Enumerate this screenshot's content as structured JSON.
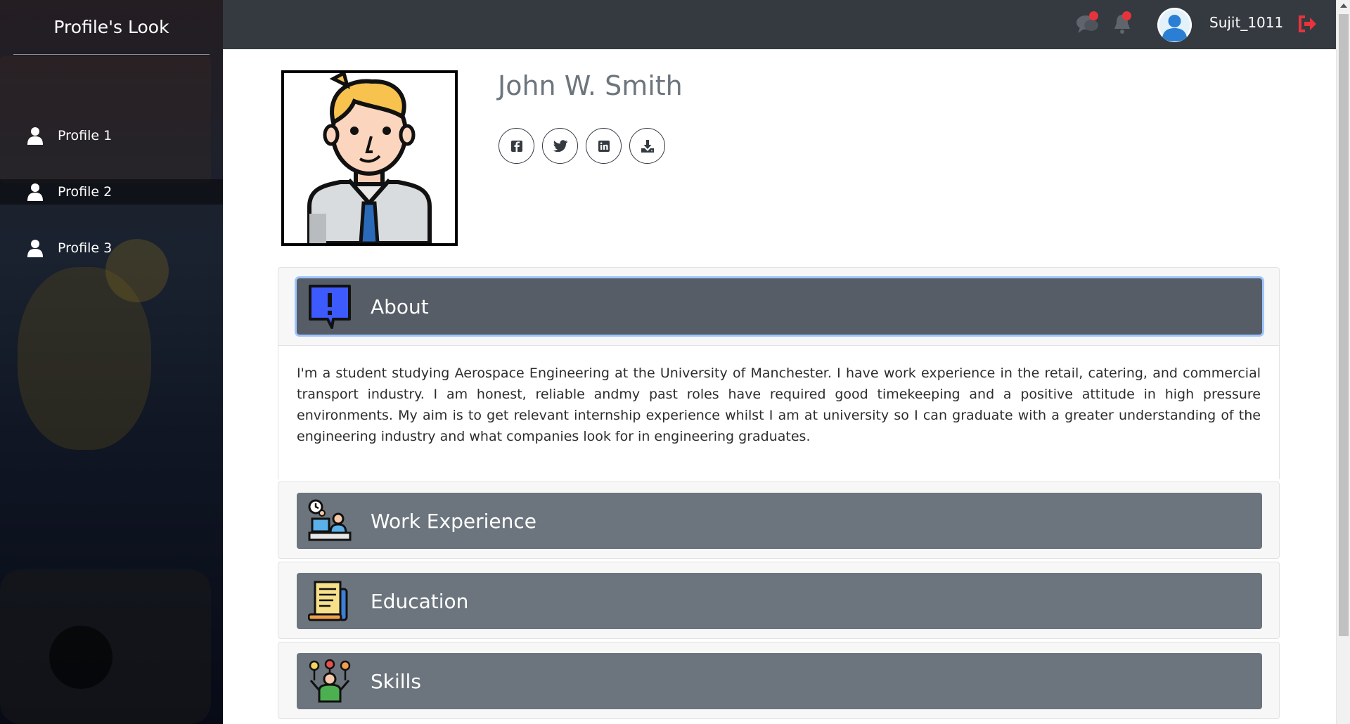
{
  "sidebar": {
    "brand": "Profile's Look",
    "items": [
      {
        "label": "Profile 1",
        "icon": "user-icon"
      },
      {
        "label": "Profile 2",
        "icon": "user-icon"
      },
      {
        "label": "Profile 3",
        "icon": "user-icon"
      }
    ],
    "active_index": 1
  },
  "topbar": {
    "icons": [
      "chat-icon",
      "bell-icon",
      "user-avatar-icon",
      "logout-icon"
    ],
    "username": "Sujit_1011",
    "badge_color": "#e8333c"
  },
  "profile": {
    "name": "John W. Smith",
    "social": [
      "facebook-icon",
      "twitter-icon",
      "linkedin-icon",
      "download-icon"
    ]
  },
  "sections": {
    "about": {
      "title": "About",
      "icon": "about-speech-bubble-icon",
      "expanded": true,
      "text": "I'm a student studying Aerospace Engineering at the University of Manchester. I have work experience in the retail, catering, and commercial transport industry. I am honest, reliable andmy past roles have required good timekeeping and a positive attitude in high pressure environments. My aim is to get relevant internship experience whilst I am at university so I can graduate with a greater understanding of the engineering industry and what companies look for in engineering graduates."
    },
    "work": {
      "title": "Work Experience",
      "icon": "work-desk-icon",
      "expanded": false
    },
    "education": {
      "title": "Education",
      "icon": "diploma-icon",
      "expanded": false
    },
    "skills": {
      "title": "Skills",
      "icon": "skills-person-icon",
      "expanded": false
    }
  },
  "colors": {
    "topbar": "#343a40",
    "header_collapsed": "#6c757d",
    "header_open": "#565d66",
    "logout": "#e8333c"
  }
}
